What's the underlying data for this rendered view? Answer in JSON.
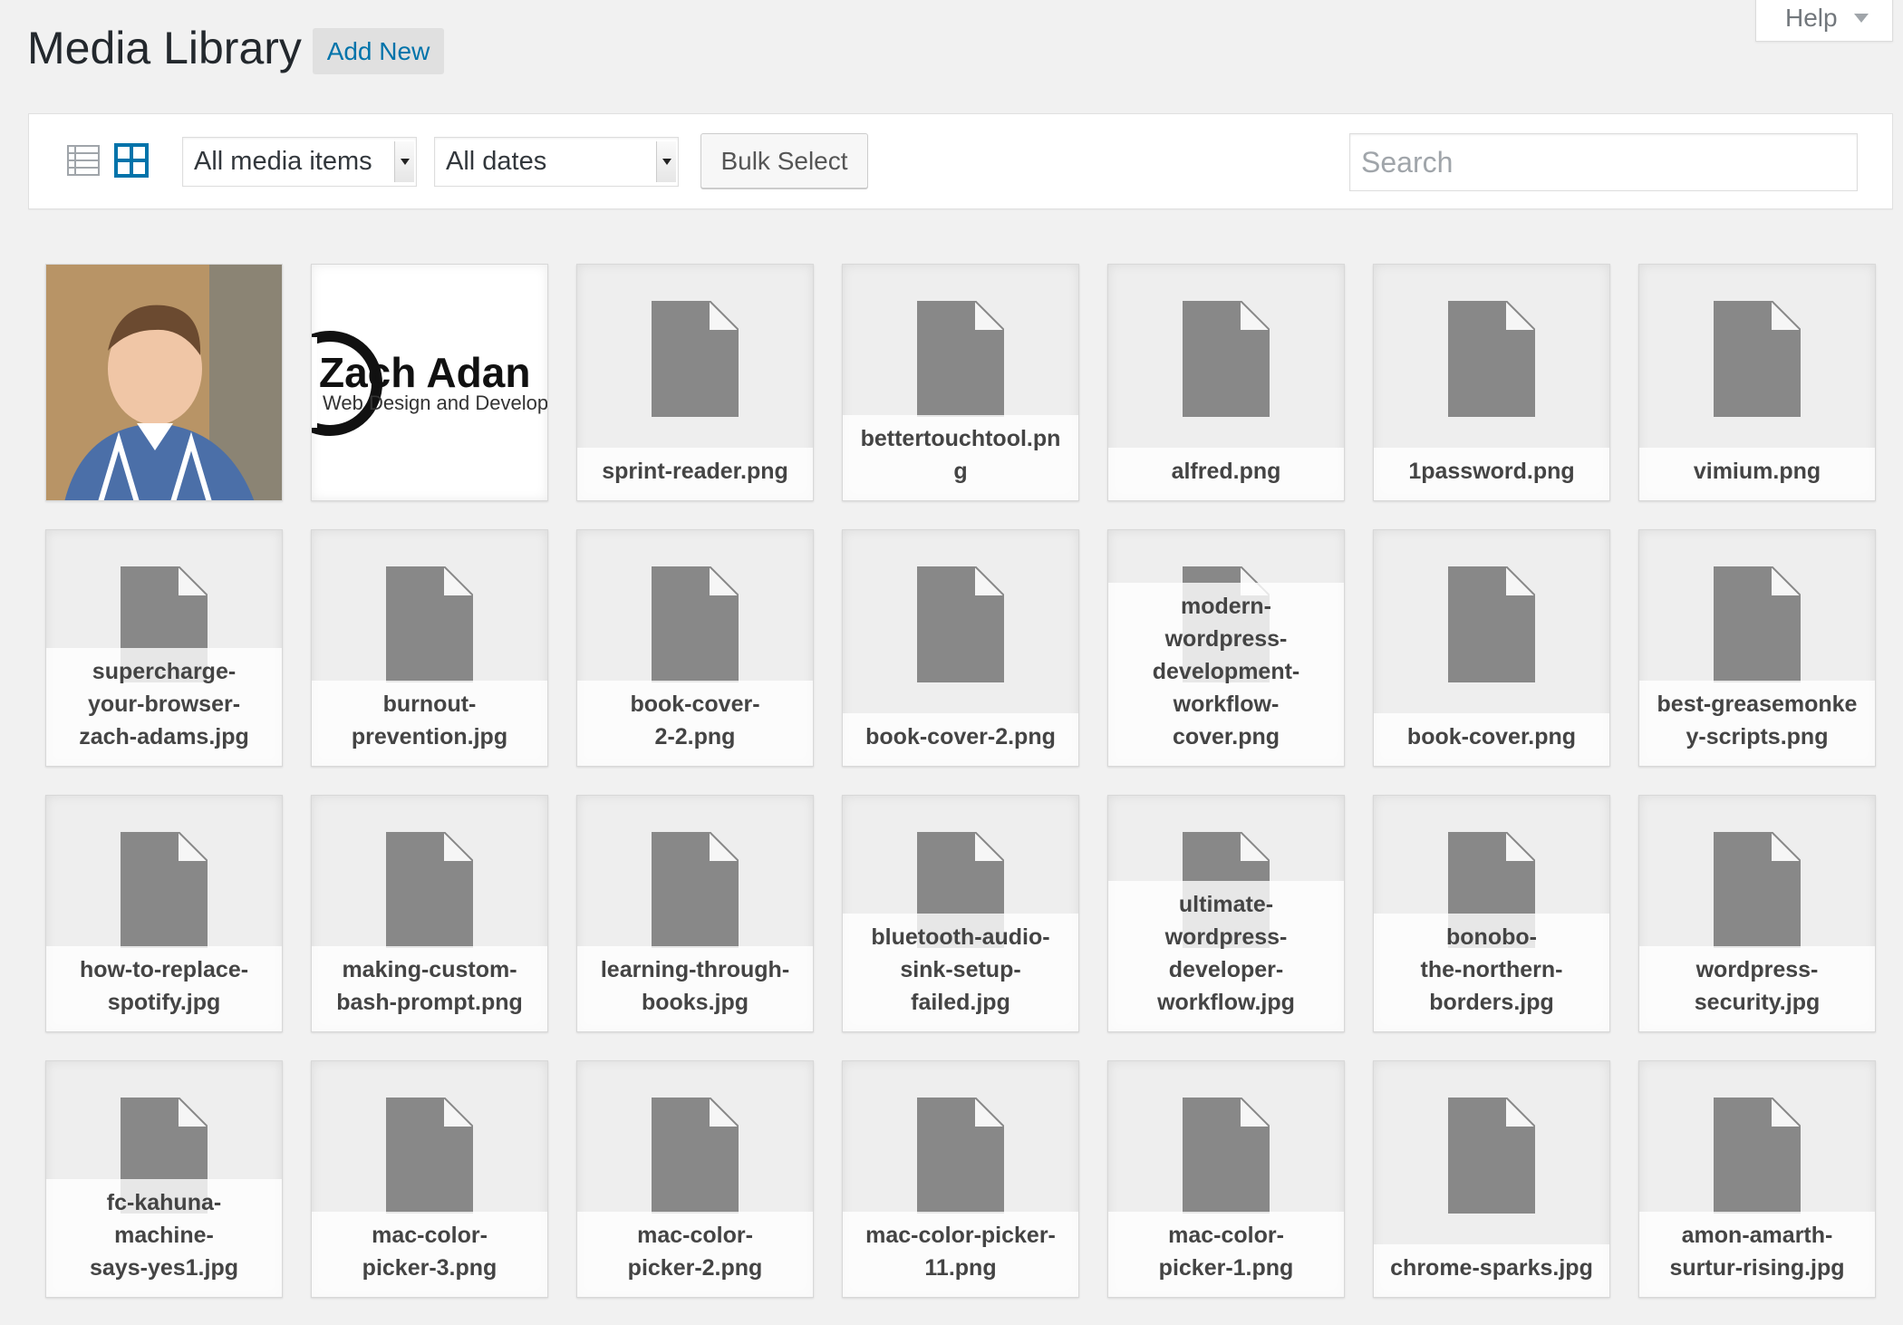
{
  "header": {
    "title": "Media Library",
    "add_new_label": "Add New",
    "help_label": "Help"
  },
  "toolbar": {
    "media_filter": "All media items",
    "date_filter": "All dates",
    "bulk_select_label": "Bulk Select",
    "search_placeholder": "Search",
    "colors": {
      "active_view": "#0073aa",
      "inactive_view": "#a0a5aa"
    }
  },
  "items": [
    {
      "type": "photo",
      "alt": ""
    },
    {
      "type": "logo",
      "logo_text": "Zach Adan",
      "logo_subtext": "Web Design and Developm"
    },
    {
      "type": "file",
      "name": "sprint-reader.png"
    },
    {
      "type": "file",
      "name": "bettertouchtool.pn\ng"
    },
    {
      "type": "file",
      "name": "alfred.png"
    },
    {
      "type": "file",
      "name": "1password.png"
    },
    {
      "type": "file",
      "name": "vimium.png"
    },
    {
      "type": "file",
      "name": "supercharge-\nyour-browser-\nzach-adams.jpg"
    },
    {
      "type": "file",
      "name": "burnout-\nprevention.jpg"
    },
    {
      "type": "file",
      "name": "book-cover-\n2-2.png"
    },
    {
      "type": "file",
      "name": "book-cover-2.png"
    },
    {
      "type": "file",
      "name": "modern-\nwordpress-\ndevelopment-\nworkflow-\ncover.png"
    },
    {
      "type": "file",
      "name": "book-cover.png"
    },
    {
      "type": "file",
      "name": "best-greasemonke\ny-scripts.png"
    },
    {
      "type": "file",
      "name": "how-to-replace-\nspotify.jpg"
    },
    {
      "type": "file",
      "name": "making-custom-\nbash-prompt.png"
    },
    {
      "type": "file",
      "name": "learning-through-\nbooks.jpg"
    },
    {
      "type": "file",
      "name": "bluetooth-audio-\nsink-setup-\nfailed.jpg"
    },
    {
      "type": "file",
      "name": "ultimate-\nwordpress-\ndeveloper-\nworkflow.jpg"
    },
    {
      "type": "file",
      "name": "bonobo-\nthe-northern-\nborders.jpg"
    },
    {
      "type": "file",
      "name": "wordpress-\nsecurity.jpg"
    },
    {
      "type": "file",
      "name": "fc-kahuna-\nmachine-\nsays-yes1.jpg"
    },
    {
      "type": "file",
      "name": "mac-color-\npicker-3.png"
    },
    {
      "type": "file",
      "name": "mac-color-\npicker-2.png"
    },
    {
      "type": "file",
      "name": "mac-color-picker-\n11.png"
    },
    {
      "type": "file",
      "name": "mac-color-\npicker-1.png"
    },
    {
      "type": "file",
      "name": "chrome-sparks.jpg"
    },
    {
      "type": "file",
      "name": "amon-amarth-\nsurtur-rising.jpg"
    }
  ]
}
